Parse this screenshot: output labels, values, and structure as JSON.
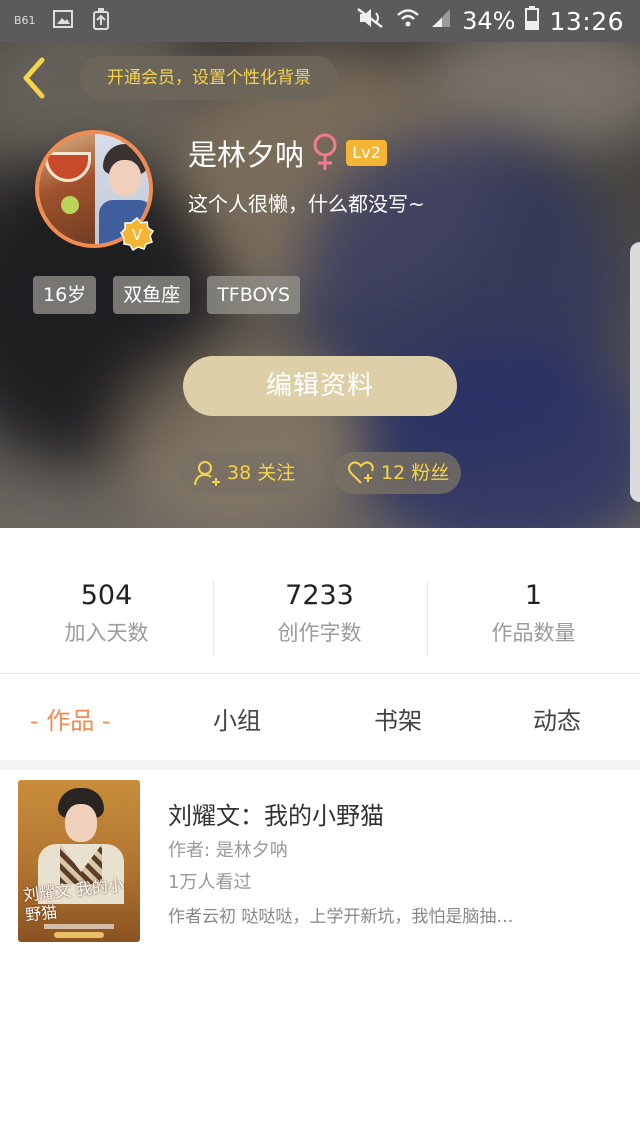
{
  "status_bar": {
    "battery": "34%",
    "time": "13:26",
    "left_icons": [
      "notification-icon",
      "image-icon",
      "cleanup-icon"
    ],
    "right_icons": [
      "mute-icon",
      "wifi-icon",
      "signal-icon",
      "battery-icon"
    ]
  },
  "header": {
    "vip_banner": "开通会员，设置个性化背景",
    "username": "是林夕呐",
    "gender": "♀",
    "level": "Lv2",
    "verified_badge": "V",
    "bio": "这个人很懒，什么都没写~",
    "tags": [
      "16岁",
      "双鱼座",
      "TFBOYS"
    ],
    "edit_button": "编辑资料",
    "following_label": "38 关注",
    "followers_label": "12 粉丝",
    "accent_color": "#f5d44a"
  },
  "stats": [
    {
      "value": "504",
      "label": "加入天数"
    },
    {
      "value": "7233",
      "label": "创作字数"
    },
    {
      "value": "1",
      "label": "作品数量"
    }
  ],
  "tabs": [
    {
      "label": "- 作品 -",
      "active": true
    },
    {
      "label": "小组",
      "active": false
    },
    {
      "label": "书架",
      "active": false
    },
    {
      "label": "动态",
      "active": false
    }
  ],
  "works": [
    {
      "title": "刘耀文：我的小野猫",
      "author": "作者: 是林夕呐",
      "views": "1万人看过",
      "description": "作者云初 哒哒哒，上学开新坑，我怕是脑抽…",
      "cover_title": "刘耀文 我的小野猫"
    }
  ],
  "colors": {
    "orange_accent": "#f08b52",
    "level_badge": "#f3b533"
  }
}
